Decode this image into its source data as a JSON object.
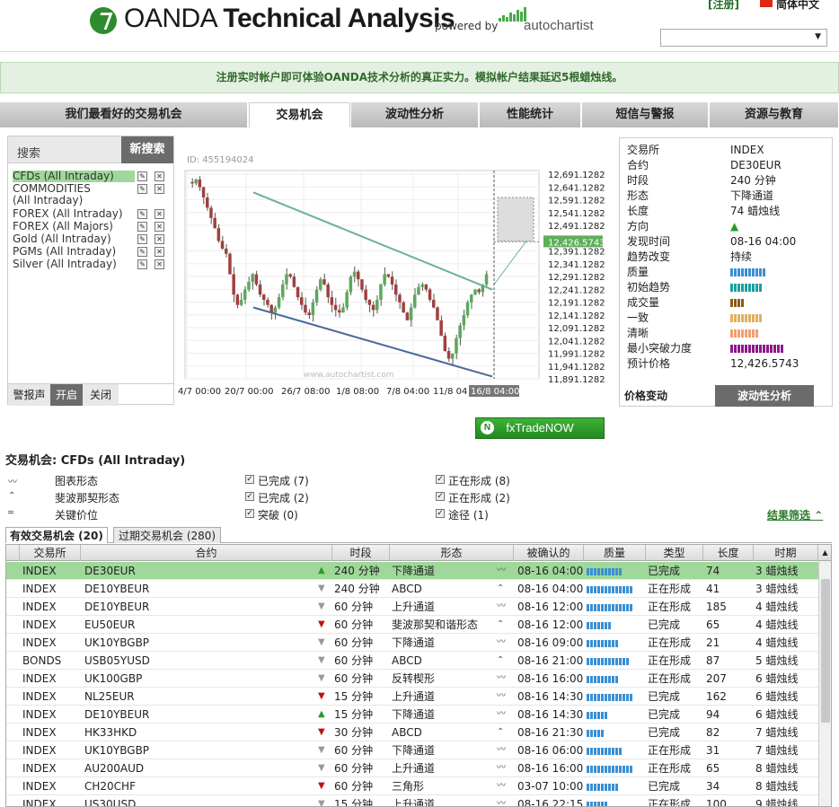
{
  "header": {
    "brand_oanda": "OANDA",
    "brand_title": "Technical Analysis",
    "powered_by": "powered by",
    "autochartist": "autochartist",
    "register": "[注册]",
    "language": "简体中文"
  },
  "banner": "注册实时帐户即可体验OANDA技术分析的真正实力。模拟帐户结果延迟5根蜡烛线。",
  "tabs": [
    "我们最看好的交易机会",
    "交易机会",
    "波动性分析",
    "性能统计",
    "短信与警报",
    "资源与教育"
  ],
  "search": {
    "label": "搜索",
    "new_search": "新搜索",
    "items": [
      "CFDs (All Intraday)",
      "COMMODITIES (All Intraday)",
      "FOREX (All Intraday)",
      "FOREX (All Majors)",
      "Gold (All Intraday)",
      "PGMs (All Intraday)",
      "Silver (All Intraday)"
    ],
    "alert_tabs": [
      "警报声",
      "开启",
      "关闭"
    ]
  },
  "chart": {
    "id": "ID: 455194024",
    "watermark": "www.autochartist.com",
    "price_labels": [
      "12,691.1282",
      "12,641.1282",
      "12,591.1282",
      "12,541.1282",
      "12,491.1282",
      "12,426.5743",
      "12,391.1282",
      "12,341.1282",
      "12,291.1282",
      "12,241.1282",
      "12,191.1282",
      "12,141.1282",
      "12,091.1282",
      "12,041.1282",
      "11,991.1282",
      "11,941.1282",
      "11,891.1282"
    ],
    "highlight_price": "12,426.5743",
    "x_labels": [
      "4/7 00:00",
      "20/7 00:00",
      "26/7 08:00",
      "1/8 08:00",
      "7/8 04:00",
      "11/8 04",
      "16/8 04:00"
    ]
  },
  "info": {
    "rows": [
      {
        "k": "交易所",
        "v": "INDEX"
      },
      {
        "k": "合约",
        "v": "DE30EUR"
      },
      {
        "k": "时段",
        "v": "240 分钟"
      },
      {
        "k": "形态",
        "v": "下降通道"
      },
      {
        "k": "长度",
        "v": "74 蜡烛线"
      },
      {
        "k": "方向",
        "v": "▲"
      },
      {
        "k": "发现时间",
        "v": "08-16 04:00"
      },
      {
        "k": "趋势改变",
        "v": "持续"
      },
      {
        "k": "质量",
        "v": ""
      },
      {
        "k": "初始趋势",
        "v": ""
      },
      {
        "k": "成交量",
        "v": ""
      },
      {
        "k": "一致",
        "v": ""
      },
      {
        "k": "清晰",
        "v": ""
      },
      {
        "k": "最小突破力度",
        "v": ""
      },
      {
        "k": "预计价格",
        "v": "12,426.5743"
      }
    ],
    "bars": [
      {
        "count": 10,
        "color": "#3a8fd3"
      },
      {
        "count": 9,
        "color": "#1aa0a0"
      },
      {
        "count": 4,
        "color": "#8a5a1a"
      },
      {
        "count": 9,
        "color": "#e0b060"
      },
      {
        "count": 8,
        "color": "#f0a070"
      },
      {
        "count": 15,
        "color": "#8a1a8a"
      }
    ],
    "tab_price": "价格变动",
    "tab_volatility": "波动性分析"
  },
  "fxtrade": "fxTradeNOW",
  "opportunities": {
    "title": "交易机会: CFDs (All Intraday)",
    "filters": [
      {
        "label": "图表形态",
        "c1": "已完成 (7)",
        "c2": "正在形成 (8)"
      },
      {
        "label": "斐波那契形态",
        "c1": "已完成 (2)",
        "c2": "正在形成 (2)"
      },
      {
        "label": "关键价位",
        "c1": "突破 (0)",
        "c2": "途径 (1)"
      }
    ],
    "filter_link": "结果筛选",
    "tab_active": "有效交易机会 (20)",
    "tab_expired": "过期交易机会 (280)"
  },
  "table": {
    "headers": [
      "交易所",
      "合约",
      "时段",
      "形态",
      "被确认的",
      "质量",
      "类型",
      "长度",
      "时期"
    ],
    "rows": [
      {
        "ex": "INDEX",
        "sym": "DE30EUR",
        "dir": "up",
        "tf": "240 分钟",
        "pat": "下降通道",
        "pi": "ch",
        "time": "08-16 04:00",
        "q": 10,
        "type": "已完成",
        "len": "74",
        "age": "3 蜡烛线"
      },
      {
        "ex": "INDEX",
        "sym": "DE10YBEUR",
        "dir": "gy",
        "tf": "240 分钟",
        "pat": "ABCD",
        "pi": "fib",
        "time": "08-16 04:00",
        "q": 13,
        "type": "正在形成",
        "len": "41",
        "age": "3 蜡烛线"
      },
      {
        "ex": "INDEX",
        "sym": "DE10YBEUR",
        "dir": "gy",
        "tf": "60 分钟",
        "pat": "上升通道",
        "pi": "ch",
        "time": "08-16 12:00",
        "q": 13,
        "type": "正在形成",
        "len": "185",
        "age": "4 蜡烛线"
      },
      {
        "ex": "INDEX",
        "sym": "EU50EUR",
        "dir": "dn",
        "tf": "60 分钟",
        "pat": "斐波那契和谐形态",
        "pi": "fib",
        "time": "08-16 12:00",
        "q": 7,
        "type": "已完成",
        "len": "65",
        "age": "4 蜡烛线"
      },
      {
        "ex": "INDEX",
        "sym": "UK10YBGBP",
        "dir": "gy",
        "tf": "60 分钟",
        "pat": "下降通道",
        "pi": "ch",
        "time": "08-16 09:00",
        "q": 9,
        "type": "正在形成",
        "len": "21",
        "age": "4 蜡烛线"
      },
      {
        "ex": "BONDS",
        "sym": "USB05YUSD",
        "dir": "gy",
        "tf": "60 分钟",
        "pat": "ABCD",
        "pi": "fib",
        "time": "08-16 21:00",
        "q": 12,
        "type": "正在形成",
        "len": "87",
        "age": "5 蜡烛线"
      },
      {
        "ex": "INDEX",
        "sym": "UK100GBP",
        "dir": "gy",
        "tf": "60 分钟",
        "pat": "反转楔形",
        "pi": "ch",
        "time": "08-16 16:00",
        "q": 9,
        "type": "正在形成",
        "len": "207",
        "age": "6 蜡烛线"
      },
      {
        "ex": "INDEX",
        "sym": "NL25EUR",
        "dir": "dn",
        "tf": "15 分钟",
        "pat": "上升通道",
        "pi": "ch",
        "time": "08-16 14:30",
        "q": 13,
        "type": "已完成",
        "len": "162",
        "age": "6 蜡烛线"
      },
      {
        "ex": "INDEX",
        "sym": "DE10YBEUR",
        "dir": "up",
        "tf": "15 分钟",
        "pat": "下降通道",
        "pi": "ch",
        "time": "08-16 14:30",
        "q": 6,
        "type": "已完成",
        "len": "94",
        "age": "6 蜡烛线"
      },
      {
        "ex": "INDEX",
        "sym": "HK33HKD",
        "dir": "dn",
        "tf": "30 分钟",
        "pat": "ABCD",
        "pi": "fib",
        "time": "08-16 21:30",
        "q": 5,
        "type": "已完成",
        "len": "82",
        "age": "7 蜡烛线"
      },
      {
        "ex": "INDEX",
        "sym": "UK10YBGBP",
        "dir": "gy",
        "tf": "60 分钟",
        "pat": "下降通道",
        "pi": "ch",
        "time": "08-16 06:00",
        "q": 10,
        "type": "正在形成",
        "len": "31",
        "age": "7 蜡烛线"
      },
      {
        "ex": "INDEX",
        "sym": "AU200AUD",
        "dir": "gy",
        "tf": "60 分钟",
        "pat": "上升通道",
        "pi": "ch",
        "time": "08-16 16:00",
        "q": 13,
        "type": "正在形成",
        "len": "65",
        "age": "8 蜡烛线"
      },
      {
        "ex": "INDEX",
        "sym": "CH20CHF",
        "dir": "dn",
        "tf": "60 分钟",
        "pat": "三角形",
        "pi": "ch",
        "time": "03-07 10:00",
        "q": 9,
        "type": "已完成",
        "len": "34",
        "age": "8 蜡烛线"
      },
      {
        "ex": "INDEX",
        "sym": "US30USD",
        "dir": "gy",
        "tf": "15 分钟",
        "pat": "上升通道",
        "pi": "ch",
        "time": "08-16 22:15",
        "q": 6,
        "type": "正在形成",
        "len": "100",
        "age": "9 蜡烛线"
      }
    ]
  }
}
